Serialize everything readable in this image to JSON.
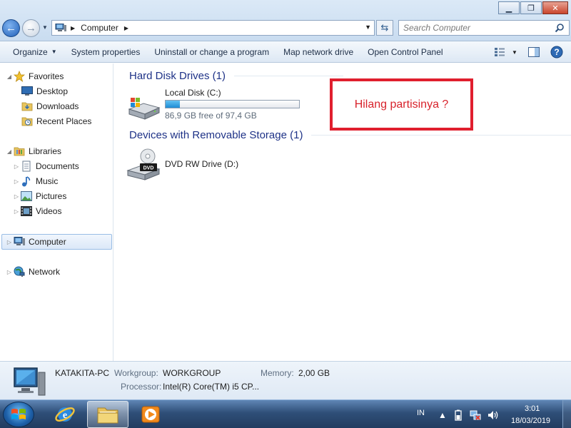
{
  "window": {
    "minimize_glyph": "▁",
    "maximize_glyph": "❐",
    "close_glyph": "✕"
  },
  "address": {
    "crumbs": [
      "Computer"
    ],
    "search_placeholder": "Search Computer"
  },
  "toolbar": {
    "organize": "Organize",
    "system_properties": "System properties",
    "uninstall": "Uninstall or change a program",
    "map_network": "Map network drive",
    "open_control_panel": "Open Control Panel"
  },
  "nav": {
    "favorites": "Favorites",
    "desktop": "Desktop",
    "downloads": "Downloads",
    "recent_places": "Recent Places",
    "libraries": "Libraries",
    "documents": "Documents",
    "music": "Music",
    "pictures": "Pictures",
    "videos": "Videos",
    "computer": "Computer",
    "network": "Network"
  },
  "content": {
    "hard_disk_header": "Hard Disk Drives (1)",
    "local_disk_label": "Local Disk (C:)",
    "local_disk_free": "86,9 GB free of 97,4 GB",
    "local_disk_used_fraction": 0.108,
    "removable_header": "Devices with Removable Storage (1)",
    "dvd_label": "DVD RW Drive (D:)",
    "dvd_badge": "DVD",
    "annotation": "Hilang partisinya ?"
  },
  "details": {
    "pc_name": "KATAKITA-PC",
    "workgroup_label": "Workgroup:",
    "workgroup_value": "WORKGROUP",
    "memory_label": "Memory:",
    "memory_value": "2,00 GB",
    "processor_label": "Processor:",
    "processor_value": "Intel(R) Core(TM) i5 CP..."
  },
  "taskbar": {
    "language": "IN",
    "time": "3:01",
    "date": "18/03/2019"
  },
  "colors": {
    "accent": "#1e3287",
    "annotation": "#e01f2e",
    "disk_fill": "#1e8cd4"
  },
  "icons": [
    "back-arrow-icon",
    "forward-arrow-icon",
    "computer-icon",
    "refresh-icon",
    "search-icon",
    "star-icon",
    "folder-icon",
    "music-note-icon",
    "hard-drive-icon",
    "dvd-drive-icon",
    "windows-start-icon",
    "internet-explorer-icon",
    "media-player-icon",
    "speaker-icon"
  ]
}
